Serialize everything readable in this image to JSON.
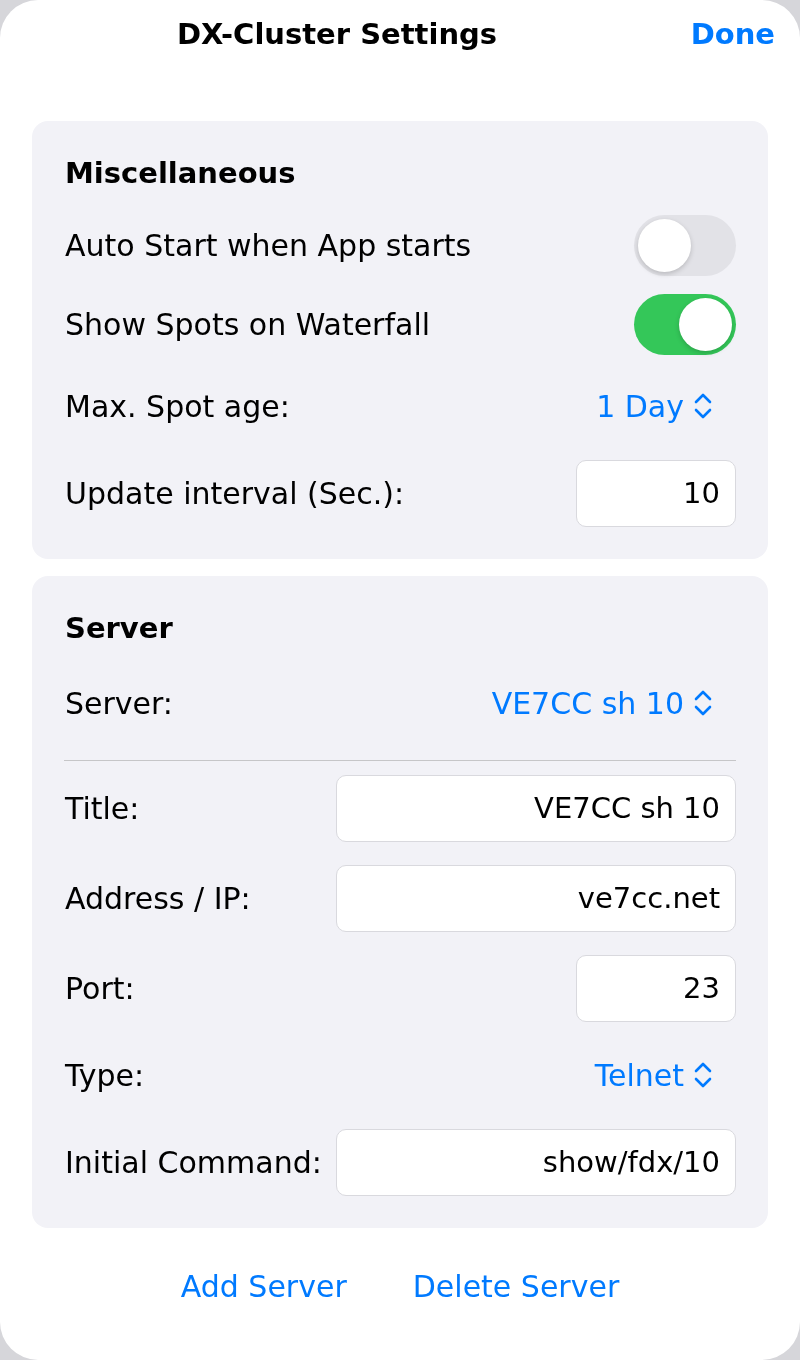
{
  "header": {
    "title": "DX-Cluster Settings",
    "done": "Done"
  },
  "sections": [
    {
      "title": "Miscellaneous",
      "rows": [
        {
          "kind": "toggle",
          "label": "Auto Start when App starts",
          "on": false
        },
        {
          "kind": "toggle",
          "label": "Show Spots on Waterfall",
          "on": true
        },
        {
          "kind": "picker",
          "label": "Max. Spot age:",
          "value": "1 Day"
        },
        {
          "kind": "number",
          "label": "Update interval (Sec.):",
          "value": "10"
        }
      ]
    },
    {
      "title": "Server",
      "rows": [
        {
          "kind": "picker",
          "label": "Server:",
          "value": "VE7CC sh 10"
        },
        {
          "kind": "divider"
        },
        {
          "kind": "text",
          "label": "Title:",
          "value": "VE7CC sh 10"
        },
        {
          "kind": "text",
          "label": "Address / IP:",
          "value": "ve7cc.net"
        },
        {
          "kind": "number",
          "label": "Port:",
          "value": "23"
        },
        {
          "kind": "picker",
          "label": "Type:",
          "value": "Telnet"
        },
        {
          "kind": "text",
          "label": "Initial Command:",
          "value": "show/fdx/10"
        }
      ]
    }
  ],
  "actions": [
    "Add Server",
    "Delete Server"
  ]
}
